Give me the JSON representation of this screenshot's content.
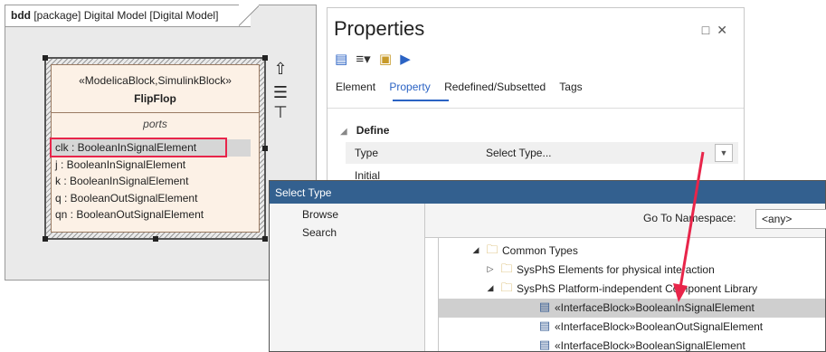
{
  "diagram": {
    "title_prefix": "bdd",
    "title_rest": " [package] Digital Model [Digital Model]",
    "block": {
      "stereotype": "«ModelicaBlock,SimulinkBlock»",
      "name": "FlipFlop",
      "compartment": "ports",
      "ports": [
        "clk : BooleanInSignalElement",
        "j : BooleanInSignalElement",
        "k : BooleanInSignalElement",
        "q : BooleanOutSignalElement",
        "qn : BooleanOutSignalElement"
      ]
    },
    "side_icons": [
      "up-arrow-icon",
      "list-icon",
      "pin-icon"
    ]
  },
  "properties": {
    "title": "Properties",
    "tabs": [
      "Element",
      "Property",
      "Redefined/Subsetted",
      "Tags"
    ],
    "active_tab": "Property",
    "section": "Define",
    "rows": [
      {
        "label": "Type",
        "value": "Select Type..."
      },
      {
        "label": "Initial",
        "value": ""
      }
    ]
  },
  "select_type": {
    "title": "Select Type",
    "nav": [
      "Browse",
      "Search"
    ],
    "namespace_label": "Go To Namespace:",
    "namespace_value": "<any>",
    "tree": [
      {
        "label": "Common Types",
        "expanded": true,
        "kind": "folder"
      },
      {
        "label": "SysPhS Elements for physical interaction",
        "expanded": false,
        "kind": "folder"
      },
      {
        "label": "SysPhS Platform-independent Component Library",
        "expanded": true,
        "kind": "folder"
      },
      {
        "label": "«InterfaceBlock»BooleanInSignalElement",
        "kind": "interfaceblock",
        "selected": true
      },
      {
        "label": "«InterfaceBlock»BooleanOutSignalElement",
        "kind": "interfaceblock"
      },
      {
        "label": "«InterfaceBlock»BooleanSignalElement",
        "kind": "interfaceblock"
      }
    ]
  },
  "colors": {
    "accent": "#2b63c4",
    "dialog_title": "#33608f",
    "highlight": "#e8254a",
    "block_fill": "#fcf1e6"
  }
}
